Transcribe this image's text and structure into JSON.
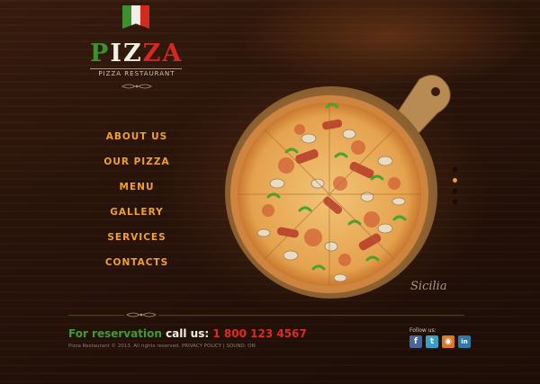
{
  "logo": {
    "letters": [
      "P",
      "I",
      "Z",
      "Z",
      "A"
    ],
    "tagline": "PIZZA RESTAURANT"
  },
  "menu": [
    {
      "label": "ABOUT US"
    },
    {
      "label": "OUR PIZZA"
    },
    {
      "label": "MENU"
    },
    {
      "label": "GALLERY"
    },
    {
      "label": "SERVICES"
    },
    {
      "label": "CONTACTS"
    }
  ],
  "slider": {
    "caption": "Sicilia",
    "dots": 4,
    "active_index": 1
  },
  "footer": {
    "reservation_label": "For reservation",
    "call_label": "call us:",
    "phone": "1 800 123 4567",
    "copyright": "Pizza Restaurant © 2013. All rights reserved.",
    "privacy_policy": "PRIVACY POLICY",
    "separator": "|",
    "sound": "SOUND: ON",
    "follow_label": "Follow us:",
    "social": [
      {
        "name": "facebook-icon",
        "glyph": "f"
      },
      {
        "name": "twitter-icon",
        "glyph": "t"
      },
      {
        "name": "rss-icon",
        "glyph": "◉"
      },
      {
        "name": "linkedin-icon",
        "glyph": "in"
      }
    ]
  },
  "colors": {
    "flag_green": "#3d8f2f",
    "flag_white": "#f1eee6",
    "flag_red": "#d4291f",
    "menu_orange": "#f0a025",
    "reservation_green": "#3f9a34",
    "phone_red": "#e0291f"
  }
}
